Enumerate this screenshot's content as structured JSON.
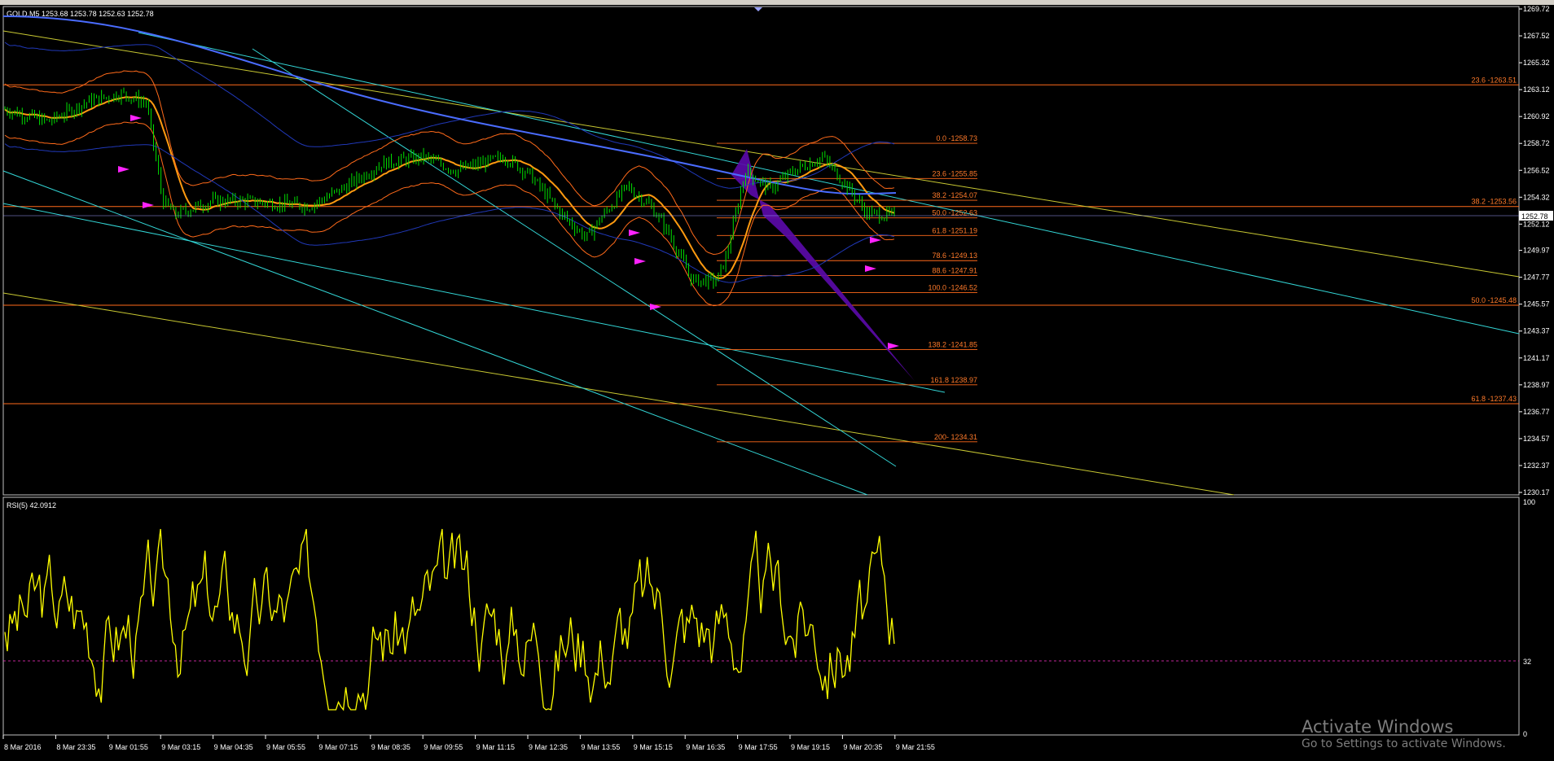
{
  "window": {
    "symbol_header": "GOLD,M5  1253.68 1253.78 1252.63 1252.78",
    "current_price": "1252.78"
  },
  "price_axis": [
    "1269.72",
    "1267.52",
    "1265.32",
    "1263.12",
    "1260.92",
    "1258.72",
    "1256.52",
    "1254.32",
    "1252.12",
    "1249.97",
    "1247.77",
    "1245.57",
    "1243.37",
    "1241.17",
    "1238.97",
    "1236.77",
    "1234.57",
    "1232.37",
    "1230.17"
  ],
  "fib_outer": [
    {
      "label": "23.6 -1263.51",
      "price": 1263.51
    },
    {
      "label": "38.2 -1253.56",
      "price": 1253.56
    },
    {
      "label": "50.0 -1245.48",
      "price": 1245.48
    },
    {
      "label": "61.8 -1237.43",
      "price": 1237.43
    }
  ],
  "fib_inner": [
    {
      "label": "0.0 -1258.73",
      "price": 1258.73
    },
    {
      "label": "23.6 -1255.85",
      "price": 1255.85
    },
    {
      "label": "38.2 -1254.07",
      "price": 1254.07
    },
    {
      "label": "50.0 -1252.63",
      "price": 1252.63
    },
    {
      "label": "61.8 -1251.19",
      "price": 1251.19
    },
    {
      "label": "78.6 -1249.13",
      "price": 1249.13
    },
    {
      "label": "88.6 -1247.91",
      "price": 1247.91
    },
    {
      "label": "100.0 -1246.52",
      "price": 1246.52
    },
    {
      "label": "138.2  -1241.85",
      "price": 1241.85
    },
    {
      "label": "161.8 1238.97",
      "price": 1238.97
    },
    {
      "label": "200- 1234.31",
      "price": 1234.31
    }
  ],
  "rsi": {
    "label": "RSI(5) 42.0912",
    "axis": [
      "100",
      "32",
      "0"
    ],
    "level": 32
  },
  "time_axis": [
    "8 Mar 2016",
    "8 Mar 23:35",
    "9 Mar 01:55",
    "9 Mar 03:15",
    "9 Mar 04:35",
    "9 Mar 05:55",
    "9 Mar 07:15",
    "9 Mar 08:35",
    "9 Mar 09:55",
    "9 Mar 11:15",
    "9 Mar 12:35",
    "9 Mar 13:55",
    "9 Mar 15:15",
    "9 Mar 16:35",
    "9 Mar 17:55",
    "9 Mar 19:15",
    "9 Mar 20:35",
    "9 Mar 21:55"
  ],
  "watermark": {
    "line1": "Activate Windows",
    "line2": "Go to Settings to activate Windows."
  },
  "colors": {
    "bull_candle": "#00e000",
    "fib_line": "#ff6a1a",
    "fib_text": "#ff7a2a",
    "channel": "#33d6d6",
    "trend_yellow": "#c8c832",
    "ma_orange": "#ff9a10",
    "ma_blue": "#4a6cff",
    "band_blue": "#2038b8",
    "pattern": "#6a0fb0",
    "arrow": "#ff22ff",
    "rsi_line": "#ffff00",
    "axis_text": "#ffffff"
  }
}
